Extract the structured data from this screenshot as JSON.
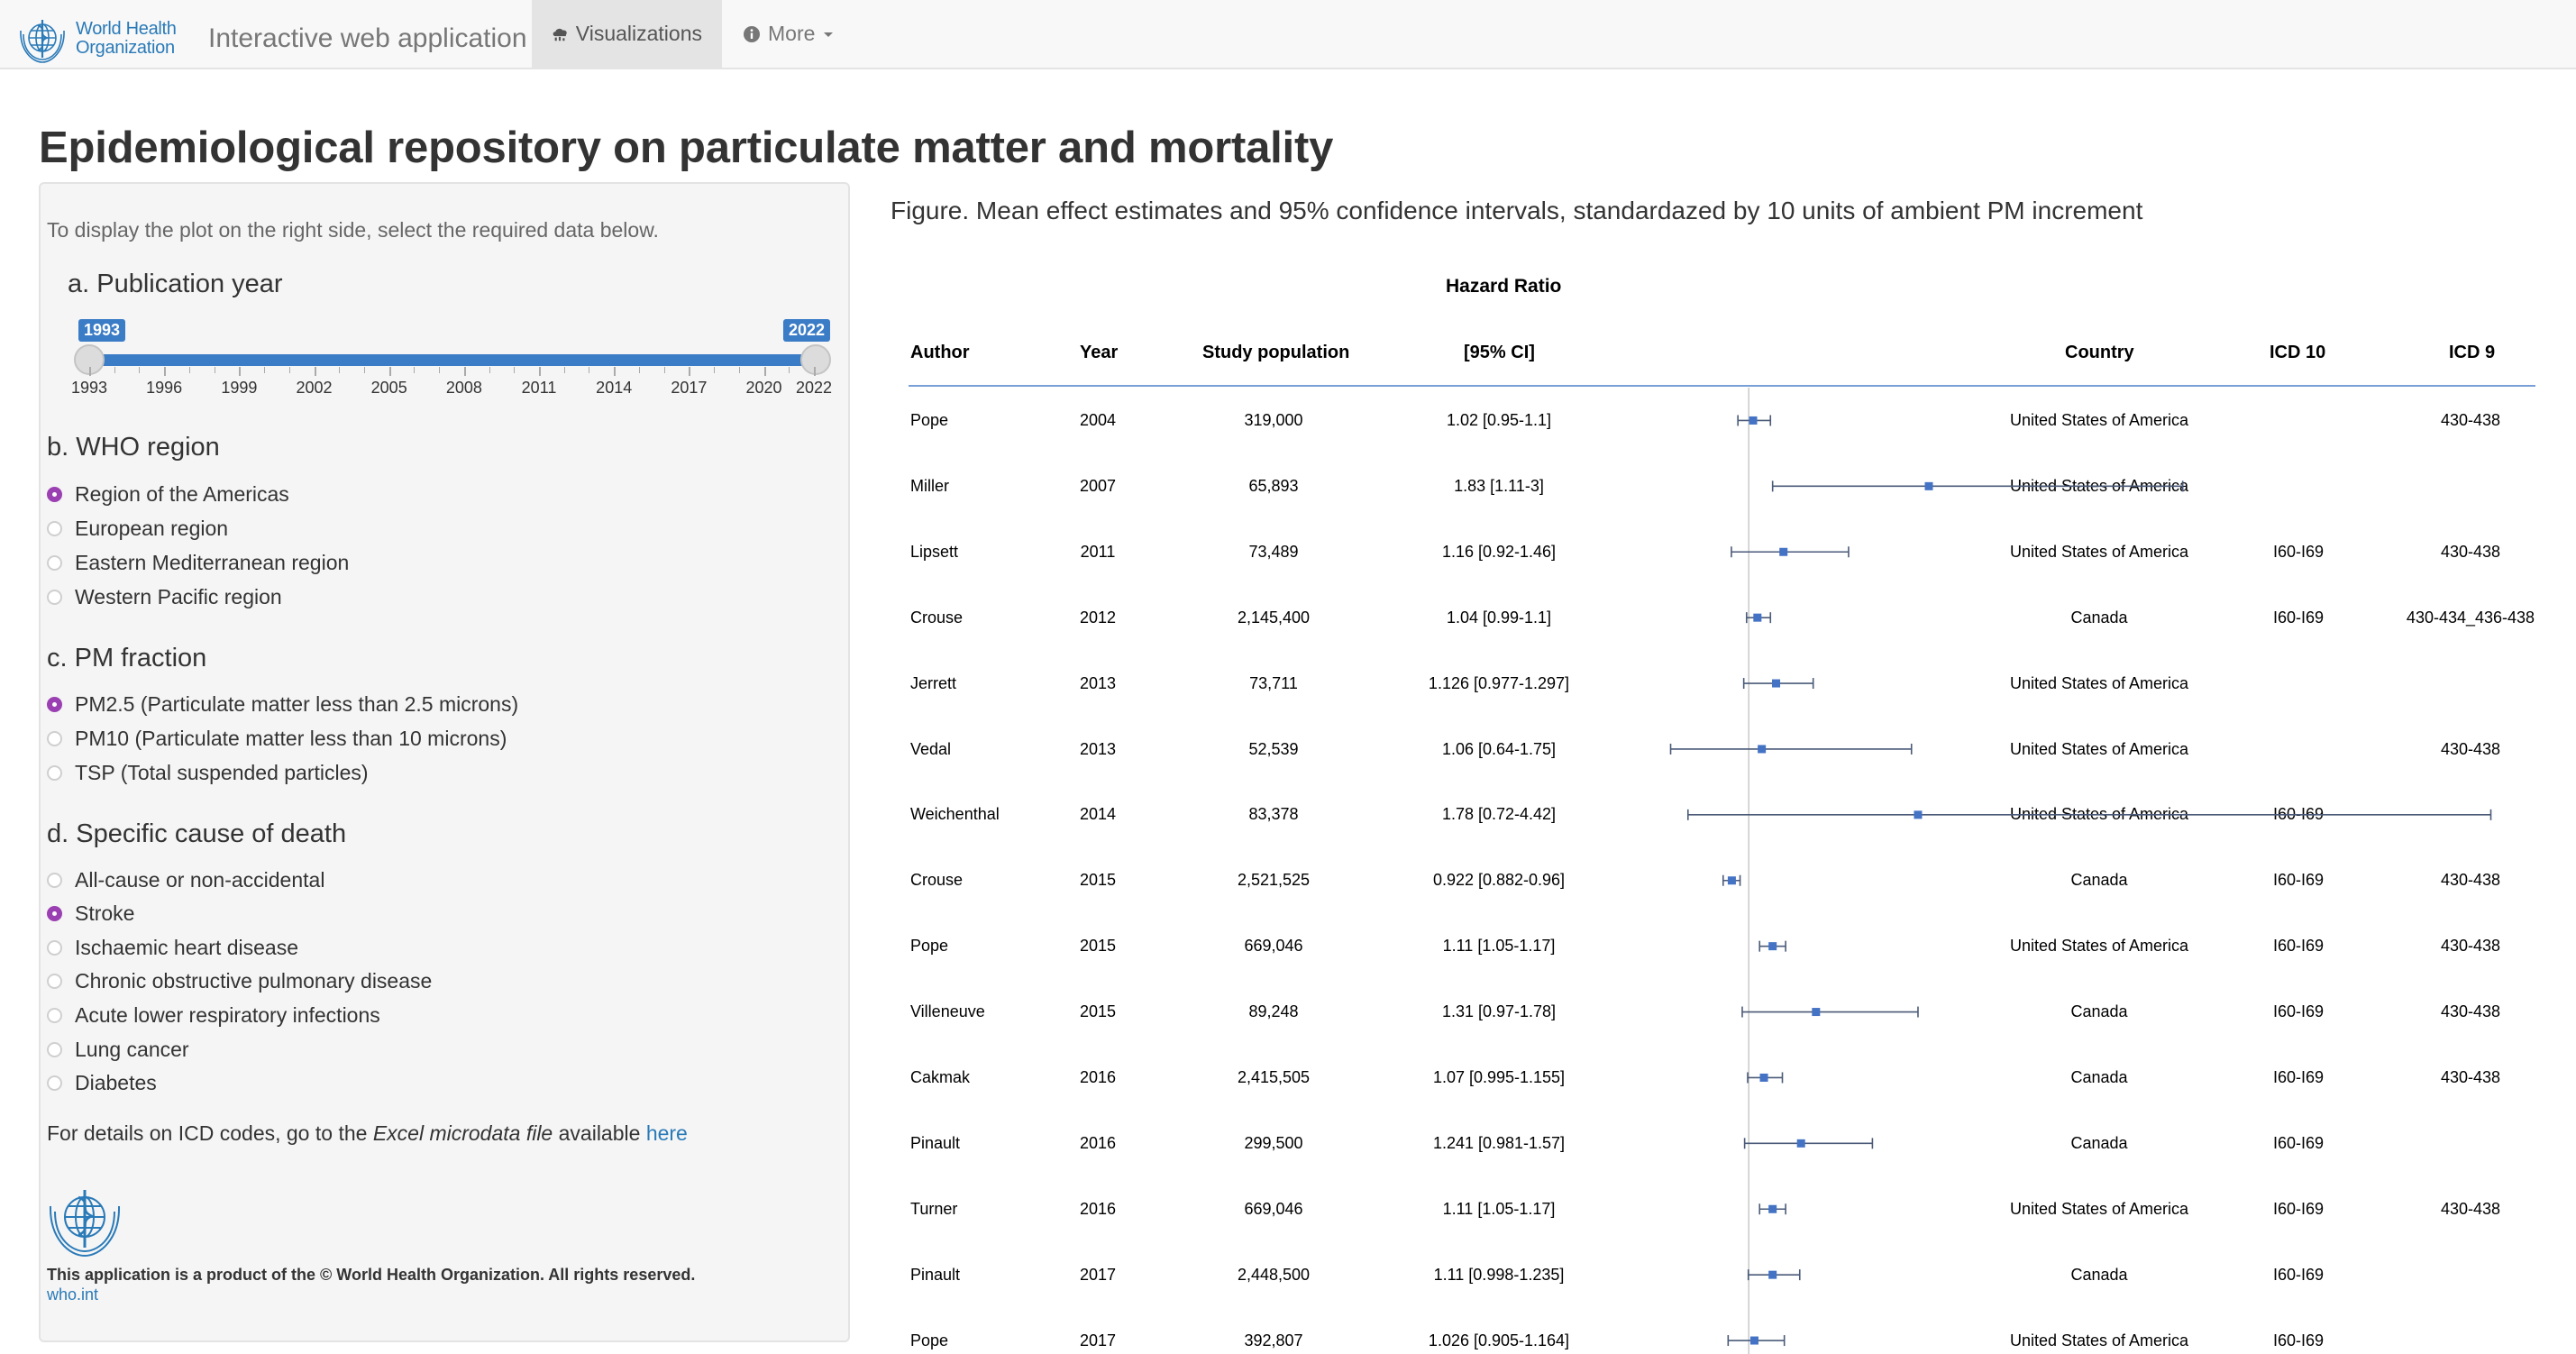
{
  "navbar": {
    "logo_text_line1": "World Health",
    "logo_text_line2": "Organization",
    "brand": "Interactive web application",
    "visualizations": "Visualizations",
    "more": "More"
  },
  "page_title": "Epidemiological repository on particulate matter and mortality",
  "sidebar": {
    "intro": "To display the plot on the right side, select the required data below.",
    "publication_year": {
      "heading": "a. Publication year",
      "min_label": "1993",
      "max_label": "2022",
      "min": 1993,
      "max": 2022,
      "tick_labels": [
        "1993",
        "1996",
        "1999",
        "2002",
        "2005",
        "2008",
        "2011",
        "2014",
        "2017",
        "2020",
        "2022"
      ]
    },
    "who_region": {
      "heading": "b. WHO region",
      "options": [
        "Region of the Americas",
        "European region",
        "Eastern Mediterranean region",
        "Western Pacific region"
      ],
      "selected": 0
    },
    "pm_fraction": {
      "heading": "c. PM fraction",
      "options": [
        "PM2.5 (Particulate matter less than 2.5 microns)",
        "PM10 (Particulate matter less than 10 microns)",
        "TSP (Total suspended particles)"
      ],
      "selected": 0
    },
    "cause_of_death": {
      "heading": "d. Specific cause of death",
      "options": [
        "All-cause or non-accidental",
        "Stroke",
        "Ischaemic heart disease",
        "Chronic obstructive pulmonary disease",
        "Acute lower respiratory infections",
        "Lung cancer",
        "Diabetes"
      ],
      "selected": 1
    },
    "details_prefix": "For details on ICD codes, go to the ",
    "details_italic": "Excel microdata file",
    "details_mid": " available ",
    "details_link": "here",
    "copyright": "This application is a product of the © World Health Organization. All rights reserved.",
    "who_link": "who.int"
  },
  "figure": {
    "title": "Figure. Mean effect estimates and 95% confidence intervals, standardazed by 10 units of ambient PM increment",
    "hr_title": "Hazard Ratio",
    "headers": {
      "author": "Author",
      "year": "Year",
      "population": "Study population",
      "ci": "[95% CI]",
      "country": "Country",
      "icd10": "ICD 10",
      "icd9": "ICD 9"
    },
    "colors": {
      "point": "#4472c4",
      "line": "#4a5a78",
      "rule": "#7a9fd6",
      "ref": "#c8c8c8"
    }
  },
  "chart_data": {
    "type": "forest",
    "reference_value": 1,
    "xlim": [
      0.6,
      4.5
    ],
    "rows": [
      {
        "author": "Pope",
        "year": "2004",
        "population": "319,000",
        "ci": "1.02 [0.95-1.1]",
        "est": 1.02,
        "lo": 0.95,
        "hi": 1.1,
        "country": "United States of America",
        "icd10": "",
        "icd9": "430-438"
      },
      {
        "author": "Miller",
        "year": "2007",
        "population": "65,893",
        "ci": "1.83 [1.11-3]",
        "est": 1.83,
        "lo": 1.11,
        "hi": 3.0,
        "country": "United States of America",
        "icd10": "",
        "icd9": ""
      },
      {
        "author": "Lipsett",
        "year": "2011",
        "population": "73,489",
        "ci": "1.16 [0.92-1.46]",
        "est": 1.16,
        "lo": 0.92,
        "hi": 1.46,
        "country": "United States of America",
        "icd10": "I60-I69",
        "icd9": "430-438"
      },
      {
        "author": "Crouse",
        "year": "2012",
        "population": "2,145,400",
        "ci": "1.04 [0.99-1.1]",
        "est": 1.04,
        "lo": 0.99,
        "hi": 1.1,
        "country": "Canada",
        "icd10": "I60-I69",
        "icd9": "430-434_436-438"
      },
      {
        "author": "Jerrett",
        "year": "2013",
        "population": "73,711",
        "ci": "1.126 [0.977-1.297]",
        "est": 1.126,
        "lo": 0.977,
        "hi": 1.297,
        "country": "United States of America",
        "icd10": "",
        "icd9": ""
      },
      {
        "author": "Vedal",
        "year": "2013",
        "population": "52,539",
        "ci": "1.06 [0.64-1.75]",
        "est": 1.06,
        "lo": 0.64,
        "hi": 1.75,
        "country": "United States of America",
        "icd10": "",
        "icd9": "430-438"
      },
      {
        "author": "Weichenthal",
        "year": "2014",
        "population": "83,378",
        "ci": "1.78 [0.72-4.42]",
        "est": 1.78,
        "lo": 0.72,
        "hi": 4.42,
        "country": "United States of America",
        "icd10": "I60-I69",
        "icd9": ""
      },
      {
        "author": "Crouse",
        "year": "2015",
        "population": "2,521,525",
        "ci": "0.922 [0.882-0.96]",
        "est": 0.922,
        "lo": 0.882,
        "hi": 0.96,
        "country": "Canada",
        "icd10": "I60-I69",
        "icd9": "430-438"
      },
      {
        "author": "Pope",
        "year": "2015",
        "population": "669,046",
        "ci": "1.11 [1.05-1.17]",
        "est": 1.11,
        "lo": 1.05,
        "hi": 1.17,
        "country": "United States of America",
        "icd10": "I60-I69",
        "icd9": "430-438"
      },
      {
        "author": "Villeneuve",
        "year": "2015",
        "population": "89,248",
        "ci": "1.31 [0.97-1.78]",
        "est": 1.31,
        "lo": 0.97,
        "hi": 1.78,
        "country": "Canada",
        "icd10": "I60-I69",
        "icd9": "430-438"
      },
      {
        "author": "Cakmak",
        "year": "2016",
        "population": "2,415,505",
        "ci": "1.07 [0.995-1.155]",
        "est": 1.07,
        "lo": 0.995,
        "hi": 1.155,
        "country": "Canada",
        "icd10": "I60-I69",
        "icd9": "430-438"
      },
      {
        "author": "Pinault",
        "year": "2016",
        "population": "299,500",
        "ci": "1.241 [0.981-1.57]",
        "est": 1.241,
        "lo": 0.981,
        "hi": 1.57,
        "country": "Canada",
        "icd10": "I60-I69",
        "icd9": ""
      },
      {
        "author": "Turner",
        "year": "2016",
        "population": "669,046",
        "ci": "1.11 [1.05-1.17]",
        "est": 1.11,
        "lo": 1.05,
        "hi": 1.17,
        "country": "United States of America",
        "icd10": "I60-I69",
        "icd9": "430-438"
      },
      {
        "author": "Pinault",
        "year": "2017",
        "population": "2,448,500",
        "ci": "1.11 [0.998-1.235]",
        "est": 1.11,
        "lo": 0.998,
        "hi": 1.235,
        "country": "Canada",
        "icd10": "I60-I69",
        "icd9": ""
      },
      {
        "author": "Pope",
        "year": "2017",
        "population": "392,807",
        "ci": "1.026 [0.905-1.164]",
        "est": 1.026,
        "lo": 0.905,
        "hi": 1.164,
        "country": "United States of America",
        "icd10": "I60-I69",
        "icd9": ""
      }
    ]
  }
}
